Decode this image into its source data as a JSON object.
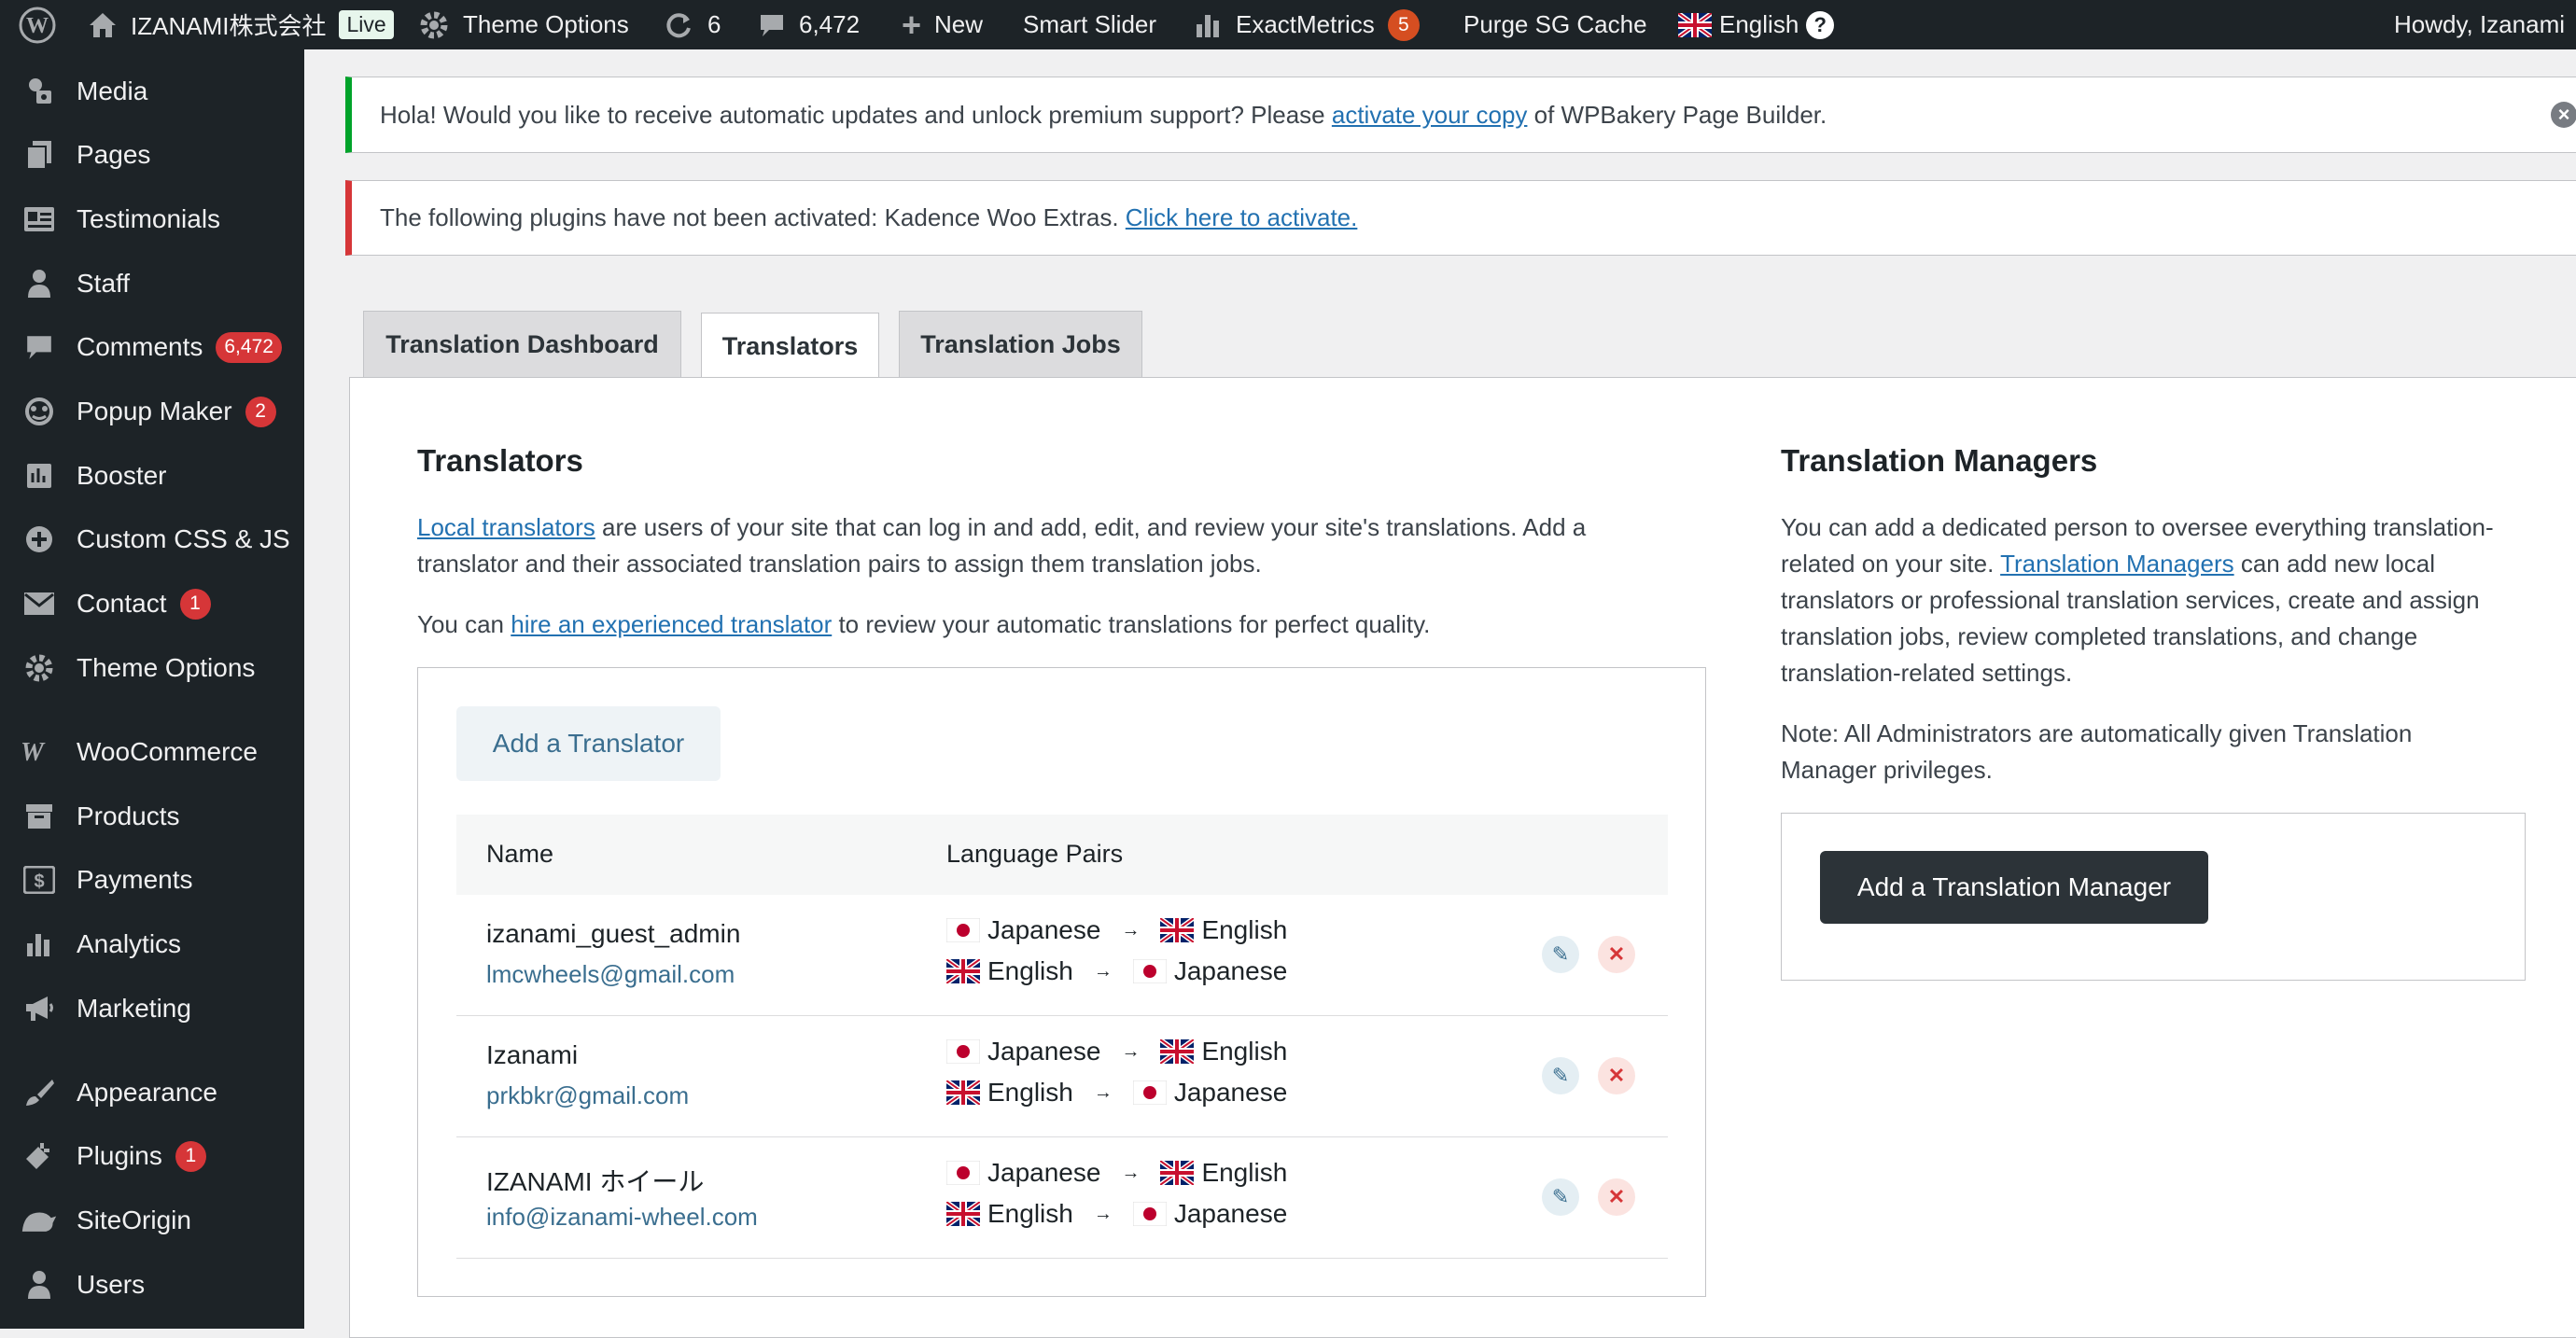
{
  "admin_bar": {
    "site_name": "IZANAMI株式会社",
    "live_label": "Live",
    "theme_options": "Theme Options",
    "updates_count": "6",
    "comments_count": "6,472",
    "new_label": "New",
    "smart_slider": "Smart Slider",
    "exactmetrics": "ExactMetrics",
    "exactmetrics_badge": "5",
    "purge_cache": "Purge SG Cache",
    "language": "English",
    "help": "?",
    "howdy": "Howdy, Izanami"
  },
  "sidebar": {
    "items": [
      {
        "label": "Media",
        "icon": "media-icon"
      },
      {
        "label": "Pages",
        "icon": "pages-icon"
      },
      {
        "label": "Testimonials",
        "icon": "testimonials-icon"
      },
      {
        "label": "Staff",
        "icon": "staff-icon"
      },
      {
        "label": "Comments",
        "icon": "comments-icon",
        "badge": "6,472"
      },
      {
        "label": "Popup Maker",
        "icon": "popup-maker-icon",
        "badge": "2"
      },
      {
        "label": "Booster",
        "icon": "booster-icon"
      },
      {
        "label": "Custom CSS & JS",
        "icon": "plus-circle-icon"
      },
      {
        "label": "Contact",
        "icon": "mail-icon",
        "badge": "1"
      },
      {
        "label": "Theme Options",
        "icon": "gear-icon"
      },
      {
        "label": "WooCommerce",
        "icon": "woocommerce-icon"
      },
      {
        "label": "Products",
        "icon": "products-icon"
      },
      {
        "label": "Payments",
        "icon": "payments-icon"
      },
      {
        "label": "Analytics",
        "icon": "analytics-icon"
      },
      {
        "label": "Marketing",
        "icon": "megaphone-icon"
      },
      {
        "label": "Appearance",
        "icon": "paintbrush-icon"
      },
      {
        "label": "Plugins",
        "icon": "plugin-icon",
        "badge": "1"
      },
      {
        "label": "SiteOrigin",
        "icon": "siteorigin-icon"
      },
      {
        "label": "Users",
        "icon": "users-icon"
      }
    ]
  },
  "notices": {
    "wpbakery": {
      "before": "Hola! Would you like to receive automatic updates and unlock premium support? Please ",
      "link": "activate your copy",
      "after": " of WPBakery Page Builder."
    },
    "plugins": {
      "before": "The following plugins have not been activated: Kadence Woo Extras. ",
      "link": "Click here to activate."
    }
  },
  "tabs": [
    "Translation Dashboard",
    "Translators",
    "Translation Jobs"
  ],
  "translators": {
    "title": "Translators",
    "intro_link": "Local translators",
    "intro_line1_rest": " are users of your site that can log in and add, edit, and review your site's translations. Add a",
    "intro_line2": "translator and their associated translation pairs to assign them translation jobs.",
    "hire_before": "You can ",
    "hire_link": "hire an experienced translator",
    "hire_after": " to review your automatic translations for perfect quality.",
    "add_button": "Add a Translator",
    "col_name": "Name",
    "col_pairs": "Language Pairs",
    "rows": [
      {
        "name": "izanami_guest_admin",
        "email": "lmcwheels@gmail.com",
        "pairs": [
          {
            "from": "Japanese",
            "to": "English"
          },
          {
            "from": "English",
            "to": "Japanese"
          }
        ]
      },
      {
        "name": "Izanami",
        "email": "prkbkr@gmail.com",
        "pairs": [
          {
            "from": "Japanese",
            "to": "English"
          },
          {
            "from": "English",
            "to": "Japanese"
          }
        ]
      },
      {
        "name": "IZANAMI ホイール",
        "email": "info@izanami-wheel.com",
        "pairs": [
          {
            "from": "Japanese",
            "to": "English"
          },
          {
            "from": "English",
            "to": "Japanese"
          }
        ]
      }
    ]
  },
  "managers": {
    "title": "Translation Managers",
    "line1": "You can add a dedicated person to oversee everything translation-",
    "line2_before": "related on your site. ",
    "line2_link": "Translation Managers",
    "line2_after": " can add new local",
    "line3": "translators or professional translation services, create and assign",
    "line4": "translation jobs, review completed translations, and change",
    "line5": "translation-related settings.",
    "note_line1": "Note: All Administrators are automatically given Translation",
    "note_line2": "Manager privileges.",
    "add_button": "Add a Translation Manager"
  },
  "colors": {
    "admin_bg": "#1d2327",
    "link": "#2271b1",
    "notice_green": "#00a32a",
    "notice_red": "#d63638",
    "badge_red": "#d63638"
  }
}
